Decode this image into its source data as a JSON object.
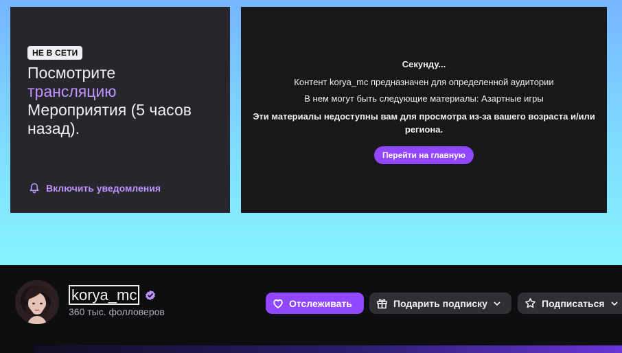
{
  "offline_card": {
    "badge": "НЕ В СЕТИ",
    "text_before": "Посмотрите",
    "link": "трансляцию",
    "text_after": "Мероприятия (5 часов назад).",
    "notify_label": "Включить уведомления"
  },
  "content_gate": {
    "title": "Секунду...",
    "line1": "Контент korya_mc предназначен для определенной аудитории",
    "line2": "В нем могут быть следующие материалы: Азартные игры",
    "warning": "Эти материалы недоступны вам для просмотра из-за вашего возраста и/или региона.",
    "button": "Перейти на главную"
  },
  "channel": {
    "name": "korya_mc",
    "followers": "360 тыс. фолловеров"
  },
  "actions": {
    "follow": "Отслеживать",
    "gift": "Подарить подписку",
    "subscribe": "Подписаться"
  },
  "colors": {
    "accent": "#9147ff",
    "accent_text": "#bf94ff"
  }
}
